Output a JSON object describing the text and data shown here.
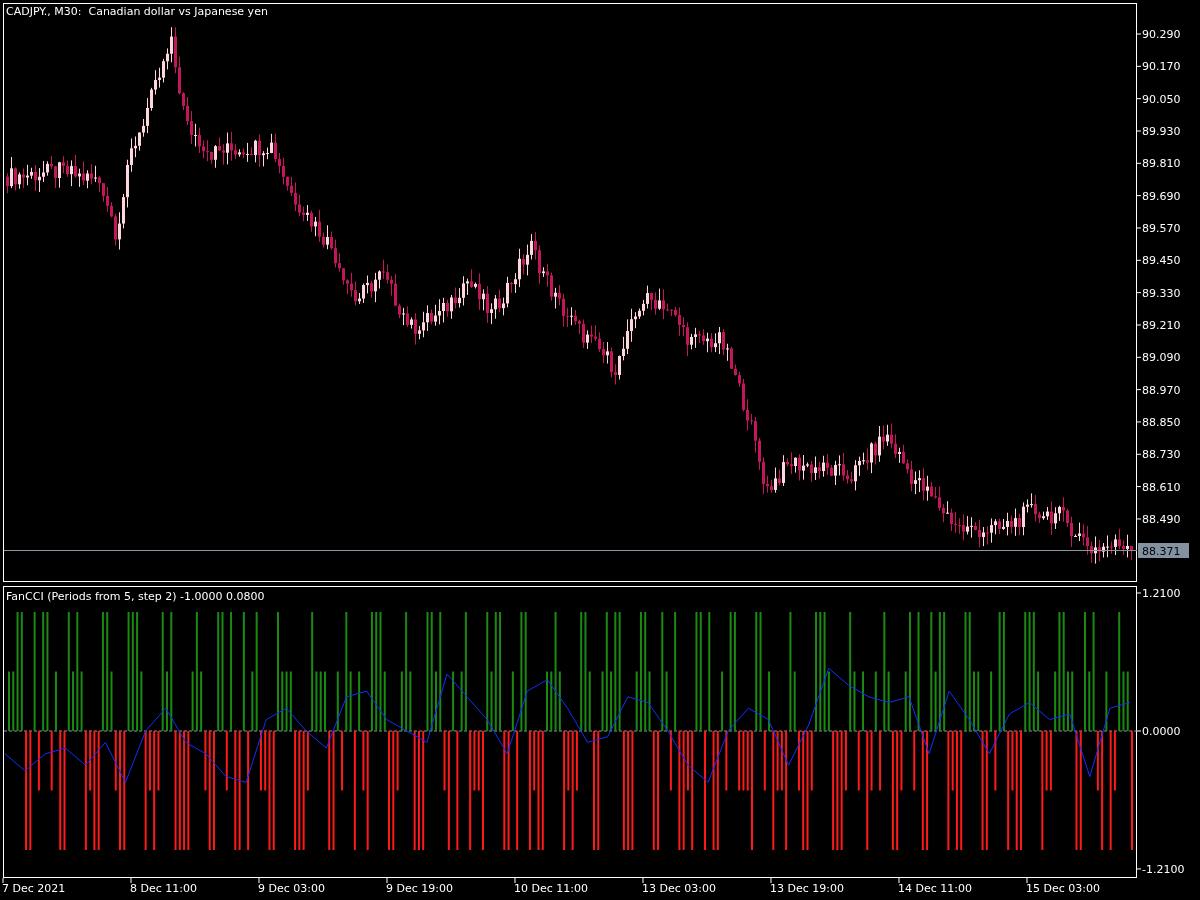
{
  "chart": {
    "title": "CADJPY., M30:  Canadian dollar vs Japanese yen",
    "price_axis": [
      "90.290",
      "90.170",
      "90.050",
      "89.930",
      "89.810",
      "89.690",
      "89.570",
      "89.450",
      "89.330",
      "89.210",
      "89.090",
      "88.970",
      "88.850",
      "88.730",
      "88.610",
      "88.490"
    ],
    "current_price": "88.371"
  },
  "indicator": {
    "title": "FanCCI (Periods from 5, step 2) -1.0000 0.0800",
    "chart_data": {
      "type": "line",
      "ylim": [
        -1.285,
        1.267
      ],
      "yticks": [
        {
          "value": 1.21,
          "label": "1.2100"
        },
        {
          "value": 0,
          "label": "0.0000"
        },
        {
          "value": -1.21,
          "label": "-1.2100"
        }
      ],
      "series": [
        {
          "color": "#1030ff",
          "values": [
            -0.2,
            -0.35,
            -0.2,
            -0.15,
            -0.3,
            -0.1,
            -0.45,
            0.0,
            0.2,
            -0.1,
            -0.2,
            -0.4,
            -0.45,
            0.1,
            0.2,
            0.0,
            -0.15,
            0.3,
            0.35,
            0.1,
            0.0,
            -0.1,
            0.5,
            0.3,
            0.1,
            -0.2,
            0.35,
            0.45,
            0.2,
            -0.1,
            -0.05,
            0.3,
            0.25,
            0.0,
            -0.3,
            -0.45,
            0.0,
            0.2,
            0.1,
            -0.3,
            0.05,
            0.55,
            0.4,
            0.3,
            0.25,
            0.3,
            -0.2,
            0.35,
            0.1,
            -0.2,
            0.15,
            0.25,
            0.1,
            0.15,
            -0.4,
            0.2,
            0.25
          ]
        }
      ]
    }
  },
  "time_axis": [
    "7 Dec 2021",
    "8 Dec 11:00",
    "9 Dec 03:00",
    "9 Dec 19:00",
    "10 Dec 11:00",
    "13 Dec 03:00",
    "13 Dec 19:00",
    "14 Dec 11:00",
    "15 Dec 03:00"
  ]
}
